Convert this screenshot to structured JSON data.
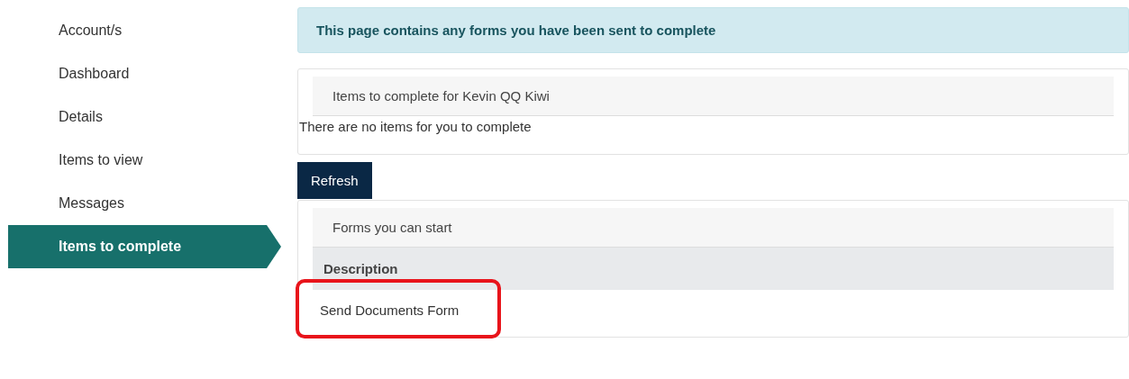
{
  "sidebar": {
    "items": [
      {
        "label": "Account/s",
        "selected": false
      },
      {
        "label": "Dashboard",
        "selected": false
      },
      {
        "label": "Details",
        "selected": false
      },
      {
        "label": "Items to view",
        "selected": false
      },
      {
        "label": "Messages",
        "selected": false
      },
      {
        "label": "Items to complete",
        "selected": true
      }
    ]
  },
  "notice": "This page contains any forms you have been sent to complete",
  "items_panel": {
    "heading": "Items to complete for Kevin QQ Kiwi",
    "empty_message": "There are no items for you to complete"
  },
  "refresh_button": "Refresh",
  "forms_panel": {
    "heading": "Forms you can start",
    "columns": [
      "Description"
    ],
    "rows": [
      {
        "cells": [
          "Send Documents Form"
        ],
        "highlighted": true
      }
    ]
  }
}
